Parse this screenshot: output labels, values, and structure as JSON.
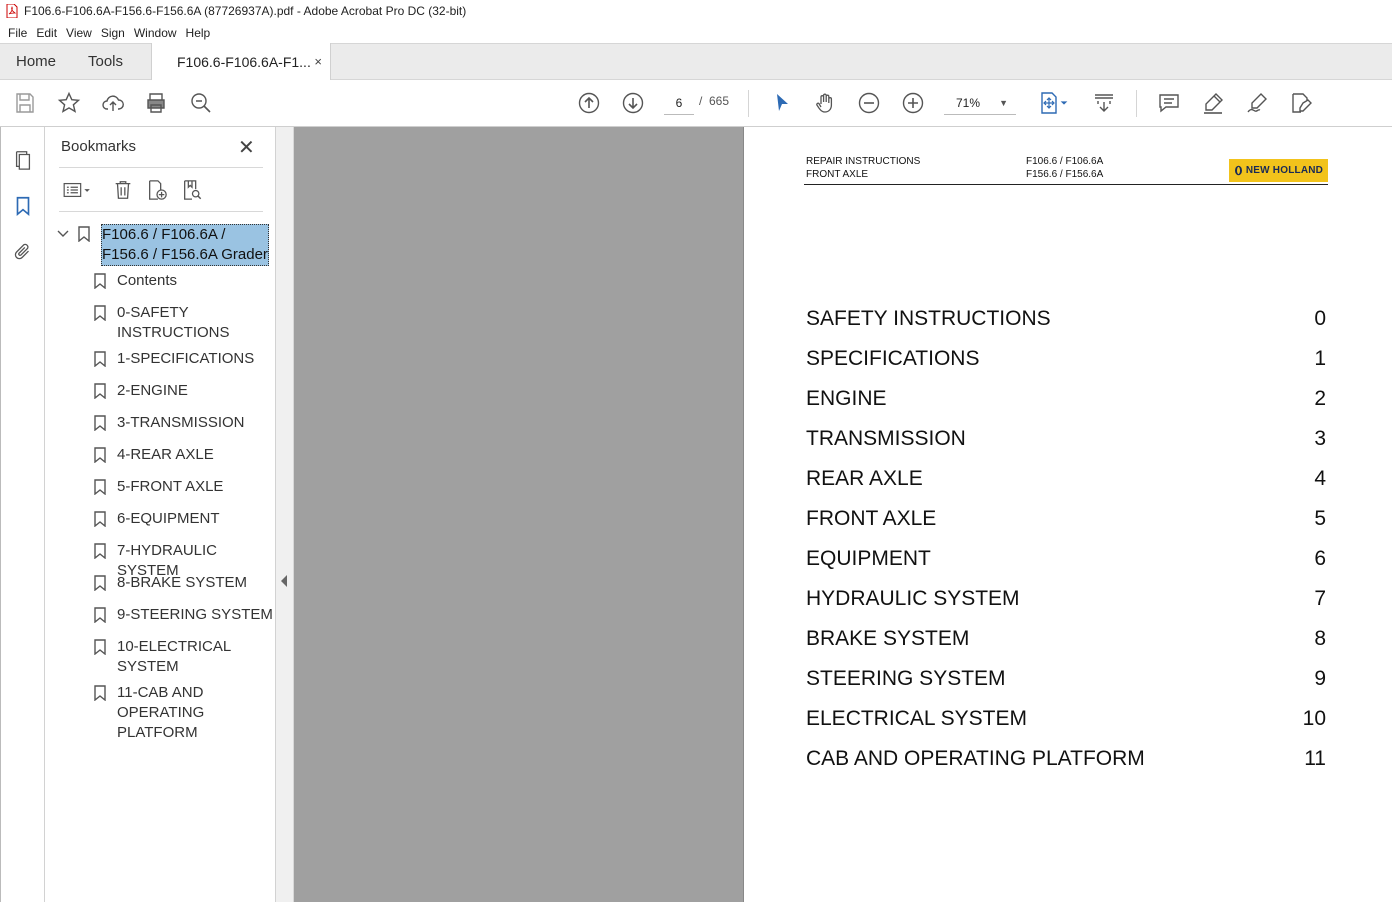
{
  "window": {
    "title": "F106.6-F106.6A-F156.6-F156.6A (87726937A).pdf - Adobe Acrobat Pro DC (32-bit)"
  },
  "menu": [
    "File",
    "Edit",
    "View",
    "Sign",
    "Window",
    "Help"
  ],
  "tabs": {
    "home": "Home",
    "tools": "Tools",
    "document": "F106.6-F106.6A-F1...",
    "close": "×"
  },
  "toolbar": {
    "page_current": "6",
    "page_separator": "/",
    "page_total": "665",
    "zoom": "71%"
  },
  "bookmarks": {
    "title": "Bookmarks",
    "close": "✕",
    "root": "F106.6 / F106.6A / F156.6 / F156.6A Grader",
    "items": [
      "Contents",
      "0-SAFETY INSTRUCTIONS",
      "1-SPECIFICATIONS",
      "2-ENGINE",
      "3-TRANSMISSION",
      "4-REAR AXLE",
      "5-FRONT AXLE",
      "6-EQUIPMENT",
      "7-HYDRAULIC SYSTEM",
      "8-BRAKE SYSTEM",
      "9-STEERING SYSTEM",
      "10-ELECTRICAL SYSTEM",
      "11-CAB AND OPERATING PLATFORM"
    ]
  },
  "document": {
    "header_left_1": "REPAIR INSTRUCTIONS",
    "header_left_2": "FRONT AXLE",
    "header_right_1": "F106.6 / F106.6A",
    "header_right_2": "F156.6 / F156.6A",
    "logo": "NEW HOLLAND",
    "toc": [
      {
        "label": "SAFETY INSTRUCTIONS",
        "num": "0"
      },
      {
        "label": "SPECIFICATIONS",
        "num": "1"
      },
      {
        "label": "ENGINE",
        "num": "2"
      },
      {
        "label": "TRANSMISSION",
        "num": "3"
      },
      {
        "label": "REAR AXLE",
        "num": "4"
      },
      {
        "label": "FRONT AXLE",
        "num": "5"
      },
      {
        "label": "EQUIPMENT",
        "num": "6"
      },
      {
        "label": "HYDRAULIC SYSTEM",
        "num": "7"
      },
      {
        "label": "BRAKE SYSTEM",
        "num": "8"
      },
      {
        "label": "STEERING SYSTEM",
        "num": "9"
      },
      {
        "label": "ELECTRICAL SYSTEM",
        "num": "10"
      },
      {
        "label": "CAB AND OPERATING PLATFORM",
        "num": "11"
      }
    ]
  },
  "colors": {
    "selection": "#9ac3e2",
    "doc_background": "#a0a0a0",
    "logo": "#f2c31b",
    "accent": "#2d6ab4"
  }
}
